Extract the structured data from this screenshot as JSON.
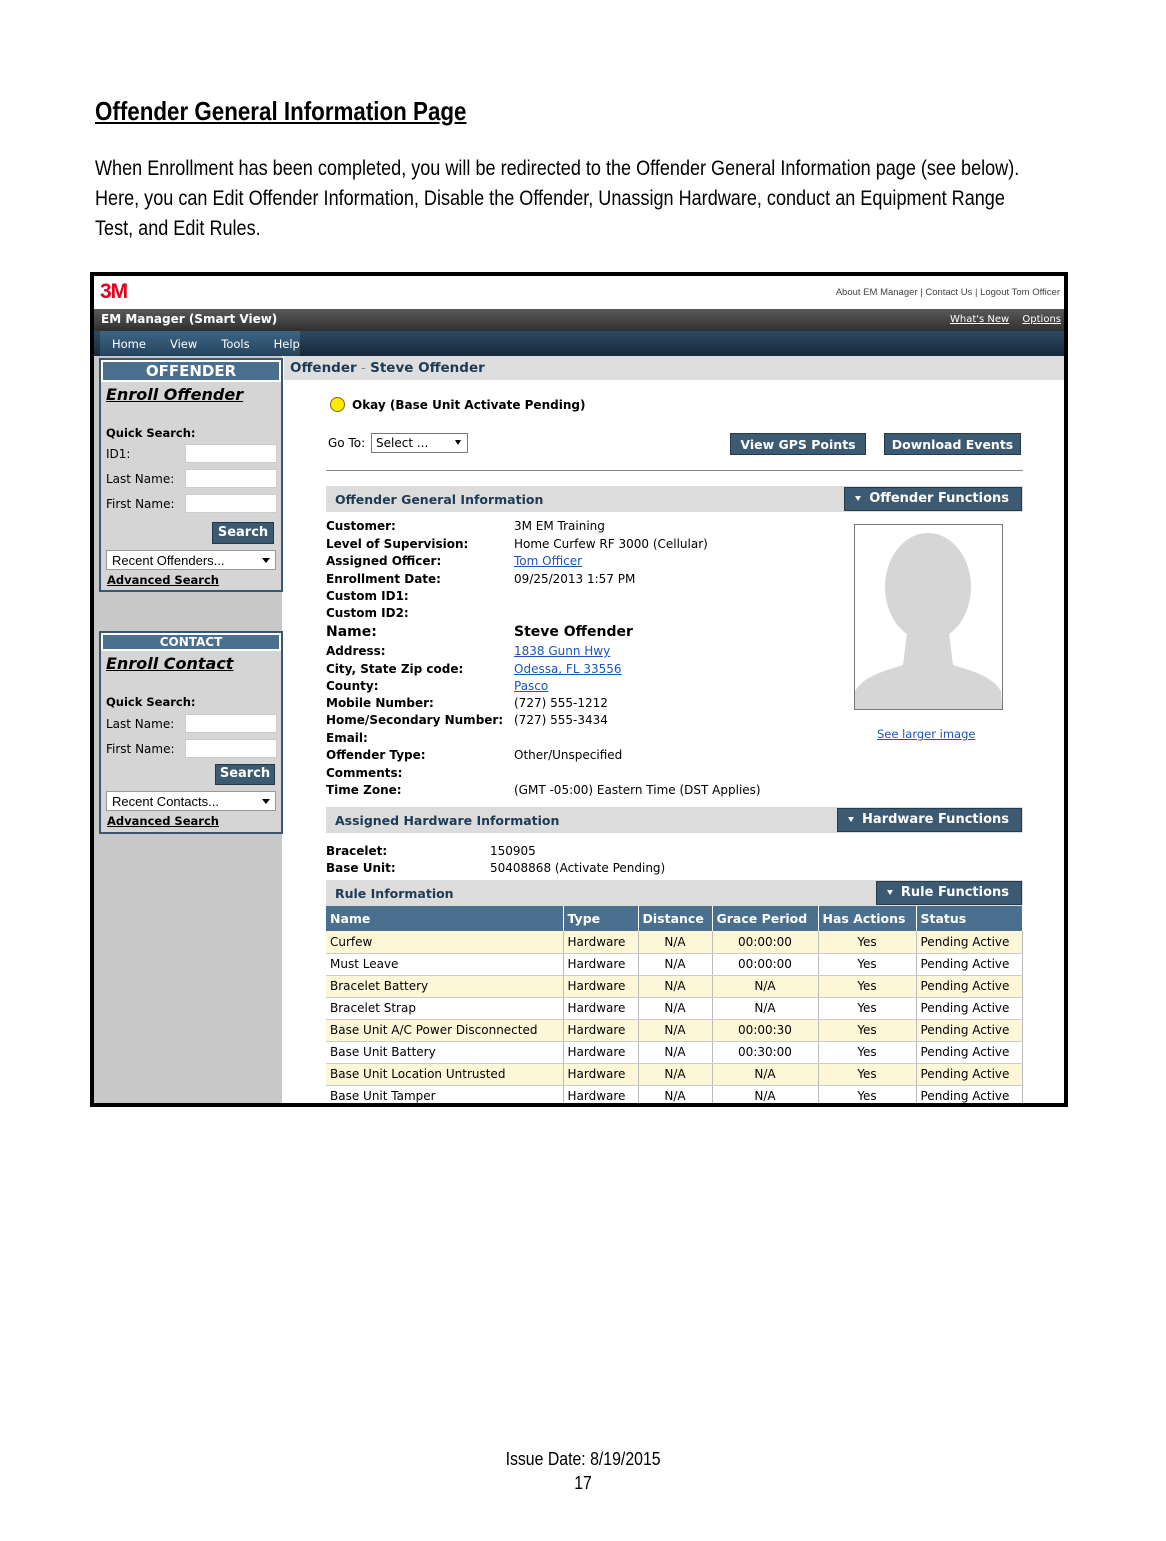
{
  "document": {
    "title": "Offender General Information Page",
    "paragraph_lines": [
      "When Enrollment has been completed, you will be redirected to the Offender General Information page (see below).",
      "Here, you can Edit Offender Information, Disable the Offender, Unassign Hardware, conduct an Equipment Range",
      "Test, and Edit Rules."
    ],
    "issue_date": "Issue Date: 8/19/2015",
    "page_number": "17"
  },
  "app": {
    "logo": "3M",
    "top_links": [
      "About EM Manager",
      "Contact Us",
      "Logout Tom Officer"
    ],
    "title": "EM Manager (Smart View)",
    "header_links": [
      "What's New",
      "Options"
    ],
    "menu": [
      "Home",
      "View",
      "Tools",
      "Help"
    ]
  },
  "sidebar": {
    "offender": {
      "header": "OFFENDER",
      "enroll": "Enroll Offender",
      "quick_search": "Quick Search:",
      "fields": [
        "ID1:",
        "Last Name:",
        "First Name:"
      ],
      "search_button": "Search",
      "recent": "Recent Offenders...",
      "advanced": "Advanced Search"
    },
    "contact": {
      "header": "CONTACT",
      "enroll": "Enroll Contact",
      "quick_search": "Quick Search:",
      "fields": [
        "Last Name:",
        "First Name:"
      ],
      "search_button": "Search",
      "recent": "Recent Contacts...",
      "advanced": "Advanced Search"
    }
  },
  "main": {
    "page_header_prefix": "Offender",
    "page_header_sep": " - ",
    "page_header_name": "Steve Offender",
    "status": "Okay (Base Unit Activate Pending)",
    "status_color": "#ffea00",
    "goto_label": "Go To:",
    "goto_value": "Select ...",
    "buttons": {
      "gps": "View GPS Points",
      "download": "Download Events"
    },
    "general": {
      "title": "Offender General Information",
      "functions": "Offender Functions",
      "fields": [
        {
          "label": "Customer:",
          "value": "3M EM Training"
        },
        {
          "label": "Level of Supervision:",
          "value": "Home Curfew RF 3000 (Cellular)"
        },
        {
          "label": "Assigned Officer:",
          "value": "Tom Officer"
        },
        {
          "label": "Enrollment Date:",
          "value": "09/25/2013 1:57 PM"
        },
        {
          "label": "Custom ID1:",
          "value": ""
        },
        {
          "label": "Custom ID2:",
          "value": ""
        },
        {
          "label": "Name:",
          "value": "Steve Offender"
        },
        {
          "label": "Address:",
          "value": "1838 Gunn Hwy"
        },
        {
          "label": "City, State Zip code:",
          "value": "Odessa, FL 33556"
        },
        {
          "label": "County:",
          "value": "Pasco"
        },
        {
          "label": "Mobile Number:",
          "value": "(727) 555-1212"
        },
        {
          "label": "Home/Secondary Number:",
          "value": "(727) 555-3434"
        },
        {
          "label": "Email:",
          "value": ""
        },
        {
          "label": "Offender Type:",
          "value": "Other/Unspecified"
        },
        {
          "label": "Comments:",
          "value": ""
        },
        {
          "label": "Time Zone:",
          "value": "(GMT -05:00) Eastern Time (DST Applies)"
        }
      ],
      "see_larger": "See larger image"
    },
    "hardware": {
      "title": "Assigned Hardware Information",
      "functions": "Hardware Functions",
      "fields": [
        {
          "label": "Bracelet:",
          "value": "150905"
        },
        {
          "label": "Base Unit:",
          "value": "50408868 (Activate Pending)"
        }
      ]
    },
    "rules": {
      "title": "Rule Information",
      "functions": "Rule Functions",
      "columns": [
        "Name",
        "Type",
        "Distance",
        "Grace Period",
        "Has Actions",
        "Status"
      ],
      "rows": [
        [
          "Curfew",
          "Hardware",
          "N/A",
          "00:00:00",
          "Yes",
          "Pending Active"
        ],
        [
          "Must Leave",
          "Hardware",
          "N/A",
          "00:00:00",
          "Yes",
          "Pending Active"
        ],
        [
          "Bracelet Battery",
          "Hardware",
          "N/A",
          "N/A",
          "Yes",
          "Pending Active"
        ],
        [
          "Bracelet Strap",
          "Hardware",
          "N/A",
          "N/A",
          "Yes",
          "Pending Active"
        ],
        [
          "Base Unit A/C Power Disconnected",
          "Hardware",
          "N/A",
          "00:00:30",
          "Yes",
          "Pending Active"
        ],
        [
          "Base Unit Battery",
          "Hardware",
          "N/A",
          "00:30:00",
          "Yes",
          "Pending Active"
        ],
        [
          "Base Unit Location Untrusted",
          "Hardware",
          "N/A",
          "N/A",
          "Yes",
          "Pending Active"
        ],
        [
          "Base Unit Tamper",
          "Hardware",
          "N/A",
          "N/A",
          "Yes",
          "Pending Active"
        ]
      ]
    }
  }
}
